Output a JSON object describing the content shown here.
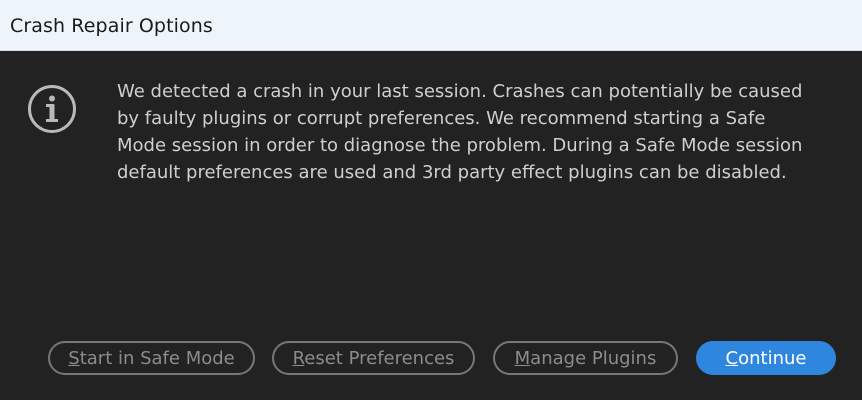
{
  "window": {
    "title": "Crash Repair Options"
  },
  "dialog": {
    "icon": "info-icon",
    "message": "We detected a crash in your last session. Crashes can potentially be caused by faulty plugins or corrupt preferences. We recommend starting a Safe Mode session in order to diagnose the problem. During a Safe Mode session default preferences are used and 3rd party effect plugins can be disabled."
  },
  "buttons": {
    "safe_mode": {
      "mnemonic": "S",
      "rest": "tart in Safe Mode"
    },
    "reset_prefs": {
      "mnemonic": "R",
      "rest": "eset Preferences"
    },
    "manage_plugins": {
      "mnemonic": "M",
      "rest": "anage Plugins"
    },
    "continue": {
      "mnemonic": "C",
      "rest": "ontinue"
    }
  },
  "colors": {
    "accent": "#2f86df",
    "titlebar": "#eef5fa",
    "background": "#222222"
  }
}
